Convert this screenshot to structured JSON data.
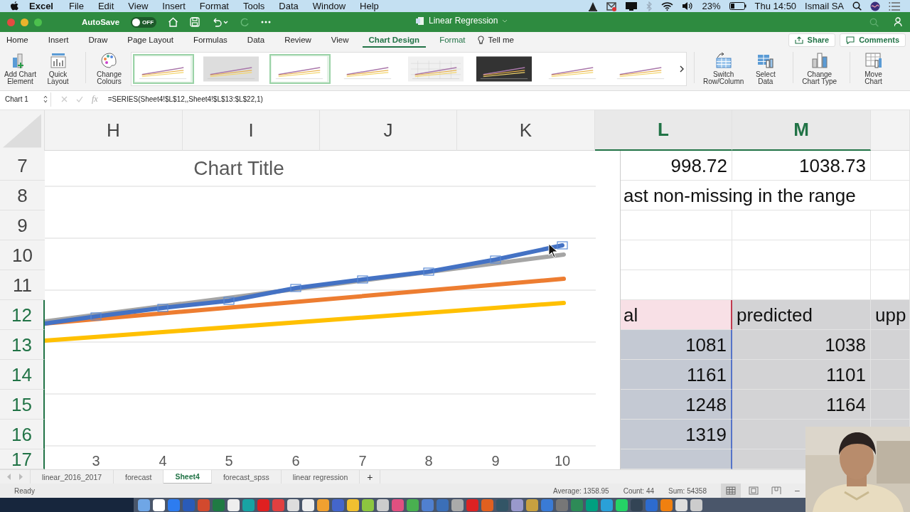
{
  "menu_bar": {
    "app": "Excel",
    "items": [
      "File",
      "Edit",
      "View",
      "Insert",
      "Format",
      "Tools",
      "Data",
      "Window",
      "Help"
    ],
    "battery": "23%",
    "clock": "Thu 14:50",
    "user": "Ismail SA"
  },
  "title_bar": {
    "autosave_label": "AutoSave",
    "autosave": {
      "on": false,
      "label": "OFF"
    },
    "title": "Linear Regression"
  },
  "ribbon_tabs": [
    {
      "label": "Home",
      "selected": false,
      "kind": "standard"
    },
    {
      "label": "Insert",
      "selected": false,
      "kind": "standard"
    },
    {
      "label": "Draw",
      "selected": false,
      "kind": "standard"
    },
    {
      "label": "Page Layout",
      "selected": false,
      "kind": "standard"
    },
    {
      "label": "Formulas",
      "selected": false,
      "kind": "standard"
    },
    {
      "label": "Data",
      "selected": false,
      "kind": "standard"
    },
    {
      "label": "Review",
      "selected": false,
      "kind": "standard"
    },
    {
      "label": "View",
      "selected": false,
      "kind": "standard"
    },
    {
      "label": "Chart Design",
      "selected": true,
      "kind": "contextual"
    },
    {
      "label": "Format",
      "selected": false,
      "kind": "contextual"
    }
  ],
  "tell_me": "Tell me",
  "share": "Share",
  "comments": "Comments",
  "ribbon_left": [
    {
      "kind": "add-element",
      "lines": [
        "Add Chart",
        "Element"
      ]
    },
    {
      "kind": "quick-layout",
      "lines": [
        "Quick",
        "Layout"
      ]
    },
    {
      "kind": "colours",
      "lines": [
        "Change",
        "Colours"
      ]
    }
  ],
  "chart_styles": [
    {
      "kind": "light",
      "highlighted": true
    },
    {
      "kind": "shaded",
      "highlighted": false
    },
    {
      "kind": "light",
      "highlighted": true
    },
    {
      "kind": "light",
      "highlighted": false
    },
    {
      "kind": "grid",
      "highlighted": false
    },
    {
      "kind": "dark",
      "highlighted": false
    },
    {
      "kind": "light",
      "highlighted": false
    },
    {
      "kind": "light",
      "highlighted": false
    }
  ],
  "ribbon_right": [
    {
      "kind": "switch",
      "lines": [
        "Switch",
        "Row/Column"
      ]
    },
    {
      "kind": "select-data",
      "lines": [
        "Select",
        "Data"
      ]
    },
    {
      "kind": "chart-type",
      "lines": [
        "Change",
        "Chart Type"
      ]
    },
    {
      "kind": "move",
      "lines": [
        "Move",
        "Chart"
      ]
    }
  ],
  "formula_bar": {
    "name_box": "Chart 1",
    "fx": "fx",
    "formula": "=SERIES(Sheet4!$L$12,,Sheet4!$L$13:$L$22,1)"
  },
  "columns": [
    {
      "label": "H",
      "selected": false
    },
    {
      "label": "I",
      "selected": false
    },
    {
      "label": "J",
      "selected": false
    },
    {
      "label": "K",
      "selected": false
    },
    {
      "label": "L",
      "selected": true
    },
    {
      "label": "M",
      "selected": true
    }
  ],
  "rows": [
    {
      "label": "7",
      "selected": false,
      "l": {
        "text": "998.72",
        "kind": "plain"
      },
      "m": {
        "text": "1038.73",
        "kind": "plain"
      },
      "n": {
        "kind": "plain"
      }
    },
    {
      "label": "8",
      "selected": false,
      "span": {
        "text": "ast non-missing in the range",
        "kind": "plain"
      }
    },
    {
      "label": "9",
      "selected": false,
      "l": {
        "kind": "plain"
      },
      "m": {
        "kind": "plain"
      },
      "n": {
        "kind": "plain"
      }
    },
    {
      "label": "10",
      "selected": false,
      "l": {
        "kind": "plain"
      },
      "m": {
        "kind": "plain"
      },
      "n": {
        "kind": "plain"
      }
    },
    {
      "label": "11",
      "selected": false,
      "l": {
        "kind": "plain"
      },
      "m": {
        "kind": "plain"
      },
      "n": {
        "kind": "plain"
      }
    },
    {
      "label": "12",
      "selected": true,
      "l": {
        "text": "al",
        "kind": "series-name"
      },
      "m": {
        "text": "predicted",
        "kind": "selected"
      },
      "n": {
        "text": "upp",
        "kind": "selected"
      }
    },
    {
      "label": "13",
      "selected": true,
      "l": {
        "text": "1081",
        "kind": "series-values"
      },
      "m": {
        "text": "1038",
        "kind": "selected"
      },
      "n": {
        "kind": "selected"
      }
    },
    {
      "label": "14",
      "selected": true,
      "l": {
        "text": "1161",
        "kind": "series-values"
      },
      "m": {
        "text": "1101",
        "kind": "selected"
      },
      "n": {
        "kind": "selected"
      }
    },
    {
      "label": "15",
      "selected": true,
      "l": {
        "text": "1248",
        "kind": "series-values"
      },
      "m": {
        "text": "1164",
        "kind": "selected"
      },
      "n": {
        "kind": "selected"
      }
    },
    {
      "label": "16",
      "selected": true,
      "l": {
        "text": "1319",
        "kind": "series-values"
      },
      "m": {
        "kind": "selected"
      },
      "n": {
        "kind": "selected"
      }
    },
    {
      "label": "17",
      "selected": true,
      "l": {
        "kind": "series-values"
      },
      "m": {
        "kind": "selected"
      }
    }
  ],
  "chart": {
    "title": "Chart Title",
    "x_labels": [
      "3",
      "4",
      "5",
      "6",
      "7",
      "8",
      "9",
      "10"
    ],
    "series": [
      {
        "selected": false
      },
      {
        "selected": false
      },
      {
        "selected": false
      },
      {
        "selected": true
      }
    ]
  },
  "sheet_tabs": [
    {
      "label": "linear_2016_2017",
      "selected": false
    },
    {
      "label": "forecast",
      "selected": false
    },
    {
      "label": "Sheet4",
      "selected": true
    },
    {
      "label": "forecast_spss",
      "selected": false
    },
    {
      "label": "linear regression",
      "selected": false
    }
  ],
  "add_sheet": "+",
  "status_bar": {
    "mode": "Ready",
    "stats": [
      "Average: 1358.95",
      "Count: 44",
      "Sum: 54358"
    ],
    "views": [
      {
        "kind": "normal",
        "selected": true
      },
      {
        "kind": "page-layout",
        "selected": false
      },
      {
        "kind": "page-break",
        "selected": false
      }
    ],
    "zoom_out": "–"
  }
}
